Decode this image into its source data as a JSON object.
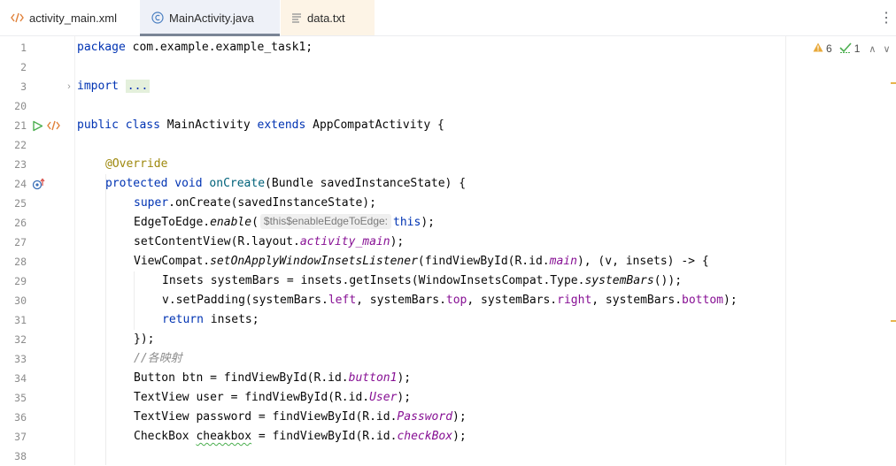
{
  "tabs": [
    {
      "label": "activity_main.xml",
      "icon": "xml-icon"
    },
    {
      "label": "MainActivity.java",
      "icon": "class-icon"
    },
    {
      "label": "data.txt",
      "icon": "text-file-icon"
    }
  ],
  "inspections": {
    "warnings": "6",
    "weak_warnings": "1"
  },
  "line_numbers": [
    "1",
    "2",
    "3",
    "20",
    "21",
    "22",
    "23",
    "24",
    "25",
    "26",
    "27",
    "28",
    "29",
    "30",
    "31",
    "32",
    "33",
    "34",
    "35",
    "36",
    "37",
    "38"
  ],
  "code": {
    "l1": {
      "kw": "package",
      "rest": " com.example.example_task1;"
    },
    "l3": {
      "kw": "import",
      "fold": "..."
    },
    "l21": {
      "kw1": "public",
      "kw2": "class",
      "name": " MainActivity ",
      "kw3": "extends",
      "rest": " AppCompatActivity {"
    },
    "l23": {
      "ann": "@Override"
    },
    "l24": {
      "kw1": "protected",
      "kw2": "void",
      "method": "onCreate",
      "rest": "(Bundle savedInstanceState) {"
    },
    "l25": {
      "kw": "super",
      "rest": ".onCreate(savedInstanceState);"
    },
    "l26": {
      "a": "EdgeToEdge.",
      "call": "enable",
      "b": "(",
      "hint": "$this$enableEdgeToEdge:",
      "kw": "this",
      "c": ");"
    },
    "l27": {
      "a": "setContentView(R.layout.",
      "fld": "activity_main",
      "b": ");"
    },
    "l28": {
      "a": "ViewCompat.",
      "call": "setOnApplyWindowInsetsListener",
      "b": "(findViewById(R.id.",
      "fld": "main",
      "c": "), (v, insets) -> {"
    },
    "l29": {
      "a": "Insets systemBars = insets.getInsets(WindowInsetsCompat.Type.",
      "call": "systemBars",
      "b": "());"
    },
    "l30": {
      "a": "v.setPadding(systemBars.",
      "f1": "left",
      "b": ", systemBars.",
      "f2": "top",
      "c": ", systemBars.",
      "f3": "right",
      "d": ", systemBars.",
      "f4": "bottom",
      "e": ");"
    },
    "l31": {
      "kw": "return",
      "rest": " insets;"
    },
    "l32": {
      "text": "});"
    },
    "l33": {
      "comment": "//各映射"
    },
    "l34": {
      "a": "Button btn = findViewById(R.id.",
      "fld": "button1",
      "b": ");"
    },
    "l35": {
      "a": "TextView user = findViewById(R.id.",
      "fld": "User",
      "b": ");"
    },
    "l36": {
      "a": "TextView password = findViewById(R.id.",
      "fld": "Password",
      "b": ");"
    },
    "l37": {
      "a": "CheckBox ",
      "squiggle": "cheakbox",
      "b": " = findViewById(R.id.",
      "fld": "checkBox",
      "c": ");"
    }
  },
  "colors": {
    "keyword": "#0033b3",
    "annotation": "#9e880d",
    "field": "#871094",
    "comment": "#8c8c8c",
    "run": "#4caf50",
    "marker": "#e6b44c"
  }
}
